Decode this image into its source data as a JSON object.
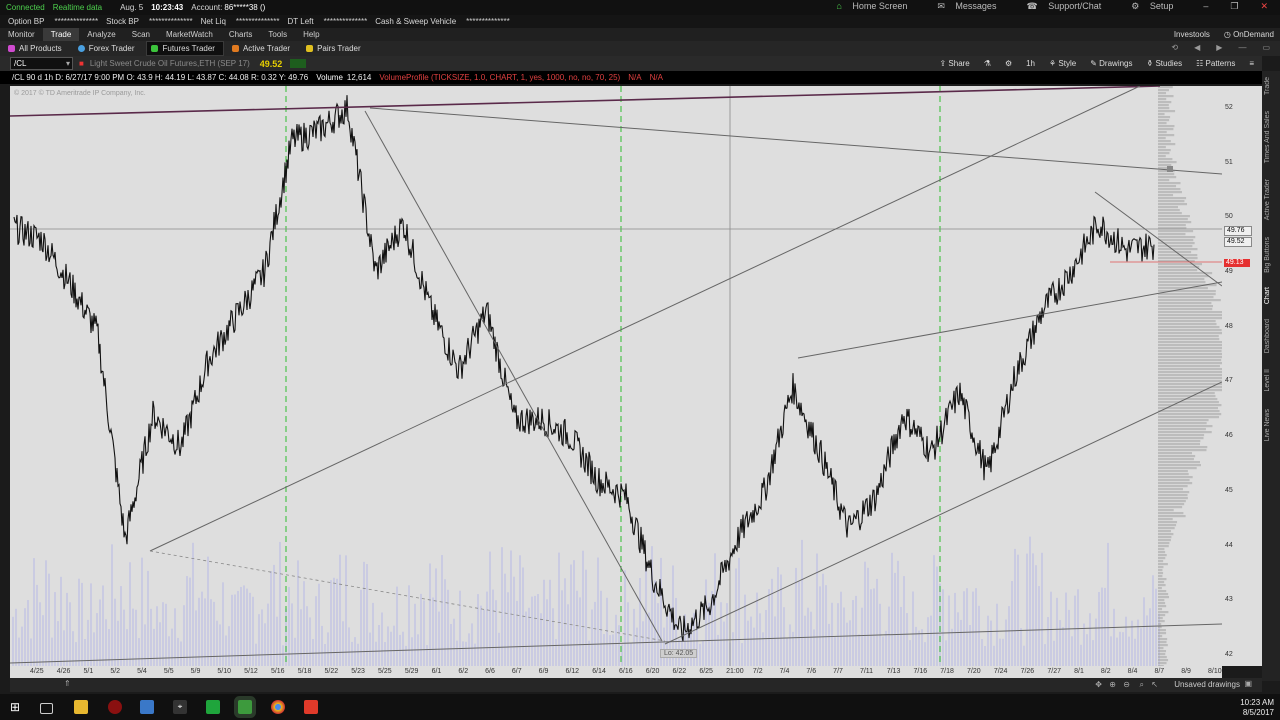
{
  "statusbar": {
    "connected": "Connected",
    "realtime": "Realtime data",
    "date": "Aug. 5",
    "time": "10:23:43",
    "account_label": "Account:",
    "account_value": "86*****38 ()",
    "home_screen": "Home Screen",
    "messages": "Messages",
    "support": "Support/Chat",
    "setup": "Setup"
  },
  "balances": {
    "items": [
      {
        "label": "Option BP",
        "value": "**************"
      },
      {
        "label": "Stock BP",
        "value": "**************"
      },
      {
        "label": "Net Liq",
        "value": "**************"
      },
      {
        "label": "DT Left",
        "value": "**************"
      },
      {
        "label": "Cash & Sweep Vehicle",
        "value": "**************"
      }
    ]
  },
  "mainnav": {
    "tabs": [
      "Monitor",
      "Trade",
      "Analyze",
      "Scan",
      "MarketWatch",
      "Charts",
      "Tools",
      "Help"
    ],
    "active": "Trade",
    "investools": "Investools",
    "ondemand": "OnDemand"
  },
  "subnav": {
    "tabs": [
      "All Products",
      "Forex Trader",
      "Futures Trader",
      "Active Trader",
      "Pairs Trader"
    ],
    "active": "Futures Trader"
  },
  "chart_toolbar": {
    "symbol": "/CL",
    "description": "Light Sweet Crude Oil Futures,ETH (SEP 17)",
    "last": "49.52",
    "share": "Share",
    "timeframe": "1h",
    "style": "Style",
    "drawings": "Drawings",
    "studies": "Studies",
    "patterns": "Patterns"
  },
  "study_line": {
    "ohlc": "/CL 90 d 1h   D: 6/27/17 9:00 PM   O: 43.9   H: 44.19   L: 43.87   C: 44.08   R: 0.32   Y: 49.76",
    "volume_label": "Volume",
    "volume_value": "12,614",
    "volume_profile": "VolumeProfile (TICKSIZE, 1.0, CHART, 1, yes, 1000, no, no, 70, 25)",
    "na1": "N/A",
    "na2": "N/A"
  },
  "chart": {
    "copyright": "© 2017 © TD Ameritrade IP Company, Inc.",
    "price_levels": [
      "52",
      "51",
      "50",
      "49",
      "48",
      "47",
      "46",
      "45",
      "44",
      "43",
      "42"
    ],
    "tags": {
      "close": "49.76",
      "last": "49.52",
      "red": "49.13"
    },
    "date_labels": [
      "4/25",
      "4/26",
      "5/1",
      "5/2",
      "5/4",
      "5/5",
      "5/9",
      "5/10",
      "5/12",
      "5/16",
      "5/18",
      "5/22",
      "5/23",
      "5/25",
      "5/29",
      "6/1",
      "6/2",
      "6/6",
      "6/7",
      "6/9",
      "6/12",
      "6/14",
      "6/16",
      "6/20",
      "6/22",
      "6/25",
      "21:00",
      "7/2",
      "7/4",
      "7/6",
      "7/7",
      "7/11",
      "7/13",
      "7/16",
      "7/18",
      "7/20",
      "7/24",
      "7/26",
      "7/27",
      "8/1",
      "8/2",
      "8/4",
      "8/7",
      "8/9",
      "8/10"
    ],
    "low_label": "Lo: 42.05"
  },
  "chart_data": {
    "type": "line",
    "ylim": [
      41.8,
      52.4
    ],
    "x": [
      "4/25",
      "4/26",
      "5/1",
      "5/2",
      "5/4",
      "5/5",
      "5/9",
      "5/10",
      "5/12",
      "5/16",
      "5/18",
      "5/22",
      "5/23",
      "5/25",
      "5/29",
      "6/1",
      "6/2",
      "6/6",
      "6/7",
      "6/9",
      "6/12",
      "6/14",
      "6/16",
      "6/20",
      "6/22",
      "6/25",
      "6/27",
      "7/2",
      "7/4",
      "7/6",
      "7/7",
      "7/11",
      "7/13",
      "7/16",
      "7/18",
      "7/20",
      "7/24",
      "7/26",
      "7/27",
      "8/1",
      "8/2",
      "8/4"
    ],
    "series": [
      {
        "values": [
          49.8,
          49.6,
          48.8,
          47.9,
          44.1,
          46.4,
          45.8,
          47.4,
          48.2,
          49.0,
          51.4,
          51.6,
          52.0,
          49.0,
          49.9,
          48.3,
          47.2,
          48.3,
          46.3,
          46.3,
          46.0,
          45.2,
          44.9,
          43.4,
          42.4,
          42.9,
          44.1,
          45.0,
          46.9,
          45.7,
          44.3,
          44.9,
          46.4,
          45.7,
          46.8,
          45.3,
          47.1,
          48.3,
          49.0,
          49.9,
          49.4,
          49.5
        ]
      }
    ]
  },
  "side_gadgets": [
    "Trade",
    "Times And Sales",
    "Active Trader",
    "Big Buttons",
    "Chart",
    "Dashboard",
    "Level II",
    "Live News"
  ],
  "chart_bottom": {
    "unsaved": "Unsaved drawings"
  },
  "taskbar": {
    "time": "10:23 AM",
    "date": "8/5/2017"
  }
}
